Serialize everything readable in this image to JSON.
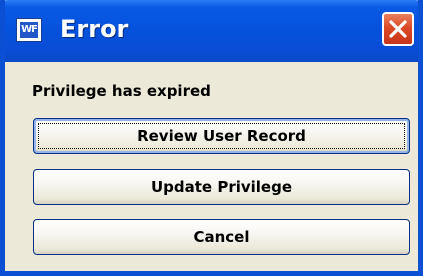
{
  "window": {
    "title": "Error",
    "app_icon_text": "WF",
    "close_icon": "close-icon"
  },
  "message": "Privilege has expired",
  "buttons": {
    "review": "Review User Record",
    "update": "Update Privilege",
    "cancel": "Cancel"
  },
  "colors": {
    "titlebar": "#0552dd",
    "frame": "#0a4fd4",
    "body": "#ece9d8",
    "close": "#dd4a26",
    "button_border": "#002f86"
  }
}
